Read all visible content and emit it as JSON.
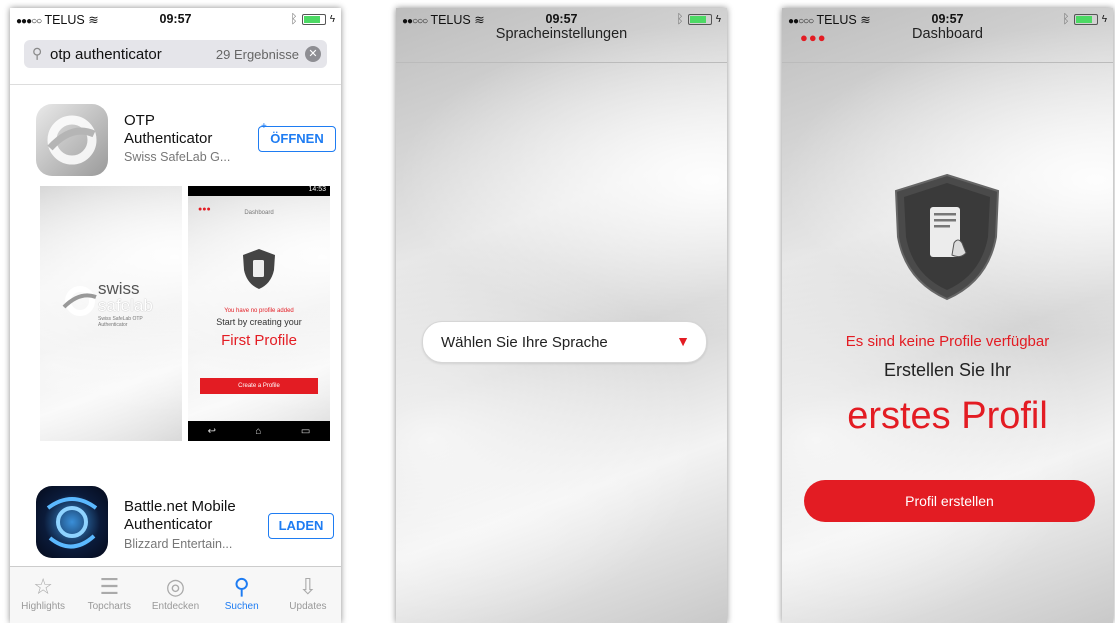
{
  "phone1": {
    "status": {
      "carrier": "TELUS",
      "time": "09:57"
    },
    "search": {
      "query": "otp authenticator",
      "count": "29 Ergebnisse"
    },
    "apps": [
      {
        "title_line1": "OTP",
        "title_line2": "Authenticator",
        "developer": "Swiss SafeLab G...",
        "button": "ÖFFNEN"
      },
      {
        "title_line1": "Battle.net Mobile",
        "title_line2": "Authenticator",
        "developer": "Blizzard Entertain...",
        "button": "LADEN"
      }
    ],
    "screenshots": {
      "brand_line1": "swiss",
      "brand_line2": "safelab",
      "brand_sub": "Swiss SafeLab OTP Authenticator",
      "mini_title": "Dashboard",
      "mini_time": "14:53",
      "mini_no_profile": "You have no profile added",
      "mini_start": "Start by creating your",
      "mini_first": "First Profile",
      "mini_button": "Create a Profile"
    },
    "tabs": [
      "Highlights",
      "Topcharts",
      "Entdecken",
      "Suchen",
      "Updates"
    ],
    "active_tab": "Suchen"
  },
  "phone2": {
    "status": {
      "carrier": "TELUS",
      "time": "09:57"
    },
    "title": "Spracheinstellungen",
    "dropdown_label": "Wählen Sie Ihre Sprache"
  },
  "phone3": {
    "status": {
      "carrier": "TELUS",
      "time": "09:57"
    },
    "title": "Dashboard",
    "no_profiles": "Es sind keine Profile verfügbar",
    "create_your": "Erstellen Sie Ihr",
    "first_profile": "erstes Profil",
    "button": "Profil erstellen"
  },
  "colors": {
    "accent_red": "#e31c23",
    "ios_blue": "#1e7cf2",
    "battery_green": "#4cd964"
  }
}
